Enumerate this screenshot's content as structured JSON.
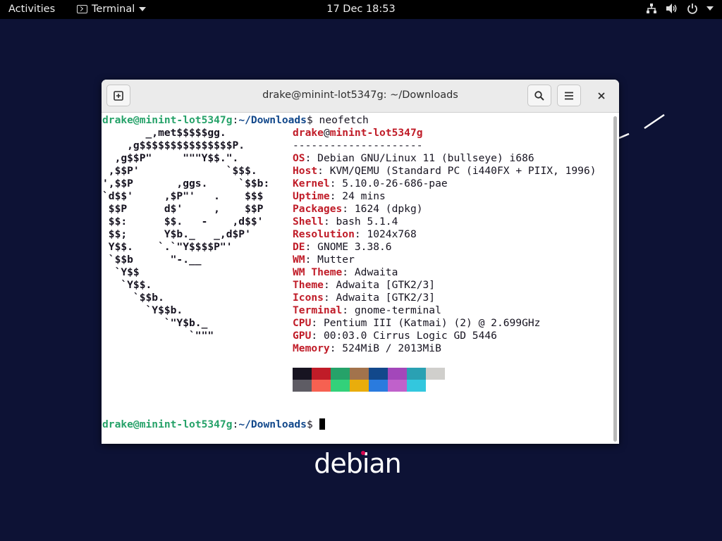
{
  "topbar": {
    "activities": "Activities",
    "app_name": "Terminal",
    "clock": "17 Dec  18:53"
  },
  "desktop": {
    "logo_text": "debian"
  },
  "window": {
    "title": "drake@minint-lot5347g: ~/Downloads"
  },
  "terminal": {
    "prompt_user_host": "drake@minint-lot5347g",
    "prompt_sep": ":",
    "prompt_path": "~/Downloads",
    "prompt_dollar": "$",
    "command": " neofetch",
    "info_user": "drake",
    "info_at": "@",
    "info_host": "minint-lot5347g",
    "info_separator": "---------------------",
    "info": [
      {
        "key": "OS",
        "value": "Debian GNU/Linux 11 (bullseye) i686"
      },
      {
        "key": "Host",
        "value": "KVM/QEMU (Standard PC (i440FX + PIIX, 1996)"
      },
      {
        "key": "Kernel",
        "value": "5.10.0-26-686-pae"
      },
      {
        "key": "Uptime",
        "value": "24 mins"
      },
      {
        "key": "Packages",
        "value": "1624 (dpkg)"
      },
      {
        "key": "Shell",
        "value": "bash 5.1.4"
      },
      {
        "key": "Resolution",
        "value": "1024x768"
      },
      {
        "key": "DE",
        "value": "GNOME 3.38.6"
      },
      {
        "key": "WM",
        "value": "Mutter"
      },
      {
        "key": "WM Theme",
        "value": "Adwaita"
      },
      {
        "key": "Theme",
        "value": "Adwaita [GTK2/3]"
      },
      {
        "key": "Icons",
        "value": "Adwaita [GTK2/3]"
      },
      {
        "key": "Terminal",
        "value": "gnome-terminal"
      },
      {
        "key": "CPU",
        "value": "Pentium III (Katmai) (2) @ 2.699GHz"
      },
      {
        "key": "GPU",
        "value": "00:03.0 Cirrus Logic GD 5446"
      },
      {
        "key": "Memory",
        "value": "524MiB / 2013MiB"
      }
    ],
    "logo_lines": [
      "       _,met$$$$$gg.",
      "    ,g$$$$$$$$$$$$$$$P.",
      "  ,g$$P\"     \"\"\"Y$$.\".",
      " ,$$P'              `$$$.",
      "',$$P       ,ggs.     `$$b:",
      "`d$$'     ,$P\"'   .    $$$",
      " $$P      d$'     ,    $$P",
      " $$:      $$.   -    ,d$$'",
      " $$;      Y$b._   _,d$P'",
      " Y$$.    `.`\"Y$$$$P\"'",
      " `$$b      \"-.__",
      "  `Y$$",
      "   `Y$$.",
      "     `$$b.",
      "       `Y$$b.",
      "          `\"Y$b._",
      "              `\"\"\""
    ],
    "palette_top": [
      "#171421",
      "#c01c28",
      "#26a269",
      "#a2734c",
      "#12488b",
      "#a347ba",
      "#2aa1b3",
      "#d0cfcc"
    ],
    "palette_bottom": [
      "#5e5c64",
      "#f66151",
      "#33d17a",
      "#e9ad0c",
      "#2a7bde",
      "#c061cb",
      "#33c7de",
      "#ffffff"
    ]
  }
}
